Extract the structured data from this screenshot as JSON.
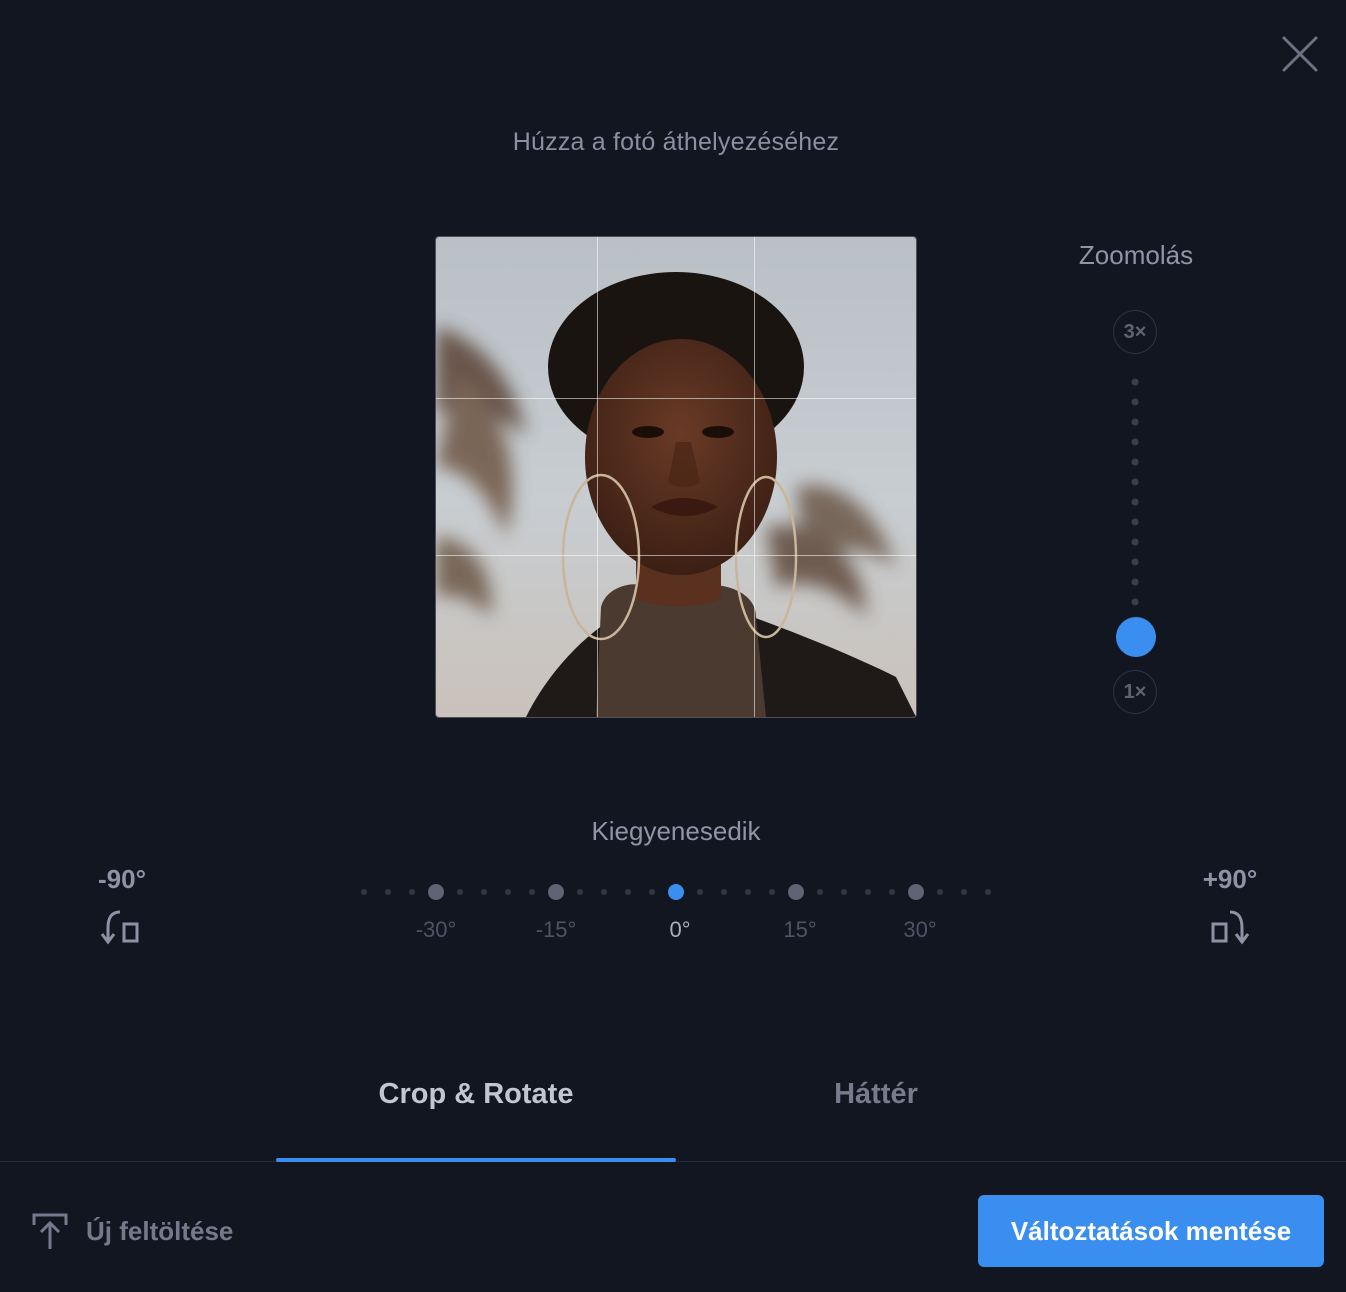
{
  "dialog": {
    "close_icon": "close-icon",
    "instruction": "Húzza a fotó áthelyezéséhez"
  },
  "zoom": {
    "label": "Zoomolás",
    "max_label": "3×",
    "min_label": "1×",
    "value": 1,
    "accent_color": "#3a8ef0"
  },
  "straighten": {
    "label": "Kiegyenesedik",
    "rotate_left_label": "-90°",
    "rotate_right_label": "+90°",
    "ticks": [
      "-30°",
      "-15°",
      "0°",
      "15°",
      "30°"
    ],
    "value_degrees": 0,
    "rotate_left_icon": "rotate-left-icon",
    "rotate_right_icon": "rotate-right-icon"
  },
  "tabs": [
    {
      "label": "Crop & Rotate",
      "active": true
    },
    {
      "label": "Háttér",
      "active": false
    }
  ],
  "footer": {
    "upload_label": "Új feltöltése",
    "upload_icon": "upload-icon",
    "save_label": "Változtatások mentése"
  },
  "colors": {
    "background": "#121621",
    "accent": "#3a8ef0"
  }
}
